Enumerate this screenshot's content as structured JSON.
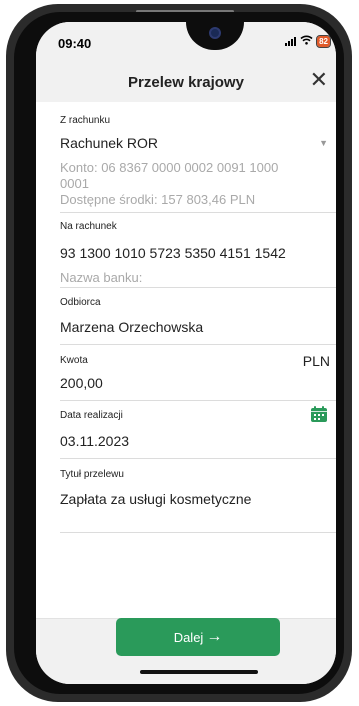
{
  "status": {
    "time": "09:40",
    "battery": "82"
  },
  "header": {
    "title": "Przelew krajowy",
    "close_symbol": "✕"
  },
  "from_account": {
    "label": "Z rachunku",
    "name": "Rachunek ROR",
    "number_line1": "Konto: 06 8367 0000 0002 0091 1000",
    "number_line2": "0001",
    "available": "Dostępne środki: 157 803,46 PLN"
  },
  "to_account": {
    "label": "Na rachunek",
    "number": "93 1300 1010 5723 5350 4151 1542",
    "bank_placeholder": "Nazwa banku:"
  },
  "recipient": {
    "label": "Odbiorca",
    "value": "Marzena Orzechowska"
  },
  "amount": {
    "label": "Kwota",
    "value": "200,00",
    "currency": "PLN"
  },
  "date": {
    "label": "Data realizacji",
    "value": "03.11.2023"
  },
  "title": {
    "label": "Tytuł przelewu",
    "value": "Zapłata za usługi kosmetyczne"
  },
  "footer": {
    "next_label": "Dalej",
    "next_arrow": "→"
  },
  "colors": {
    "accent": "#2a9a5a",
    "background_grey": "#f1f1f1"
  },
  "icons": [
    "signal-icon",
    "wifi-icon",
    "battery-icon",
    "close-icon",
    "chevron-down-icon",
    "calendar-icon",
    "arrow-right-icon"
  ]
}
